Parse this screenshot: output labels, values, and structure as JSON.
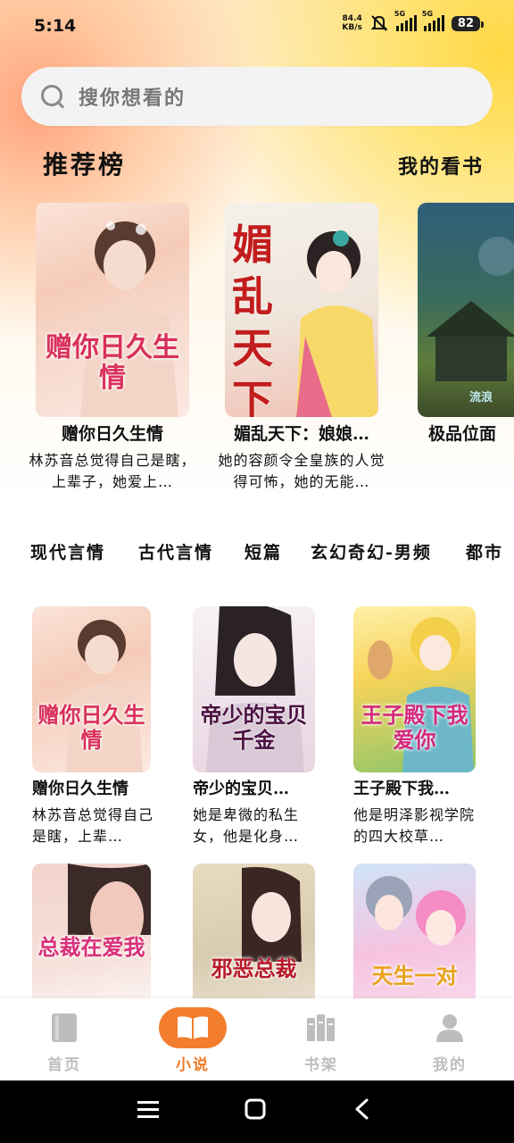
{
  "status_bar": {
    "time": "5:14",
    "net_speed_value": "84.4",
    "net_speed_unit": "KB/s",
    "signal1_label": "5G",
    "signal2_label": "5G",
    "battery": "82"
  },
  "search": {
    "placeholder": "搜你想看的"
  },
  "recommend": {
    "title": "推荐榜",
    "link": "我的看书",
    "books": [
      {
        "name": "赠你日久生情",
        "desc": "林苏音总觉得自己是瞎，上辈子，她爱上…",
        "cover_title": "赠你日久生情"
      },
      {
        "name": "媚乱天下：娘娘…",
        "desc": "她的容颜令全皇族的人觉得可怖，她的无能…",
        "cover_title": "媚乱天下"
      },
      {
        "name": "极品位面",
        "desc": "",
        "cover_title": "流浪"
      }
    ]
  },
  "categories": [
    "现代言情",
    "古代言情",
    "短篇",
    "玄幻奇幻-男频",
    "都市"
  ],
  "grid": [
    {
      "name": "赠你日久生情",
      "desc": "林苏音总觉得自己是瞎，上辈…",
      "cover_title": "赠你日久生情"
    },
    {
      "name": "帝少的宝贝…",
      "desc": "她是卑微的私生女，他是化身…",
      "cover_title": "帝少的宝贝千金"
    },
    {
      "name": "王子殿下我…",
      "desc": "他是明泽影视学院的四大校草…",
      "cover_title": "王子殿下我爱你"
    },
    {
      "name": "",
      "desc": "",
      "cover_title": "总裁在爱我"
    },
    {
      "name": "",
      "desc": "",
      "cover_title": "邪恶总裁"
    },
    {
      "name": "",
      "desc": "",
      "cover_title": "天生一对"
    }
  ],
  "bottom_nav": [
    {
      "label": "首页",
      "icon": "home-book-icon",
      "active": false
    },
    {
      "label": "小说",
      "icon": "open-book-icon",
      "active": true
    },
    {
      "label": "书架",
      "icon": "bookshelf-icon",
      "active": false
    },
    {
      "label": "我的",
      "icon": "profile-icon",
      "active": false
    }
  ],
  "colors": {
    "accent": "#f27d2d",
    "inactive": "#bdbdbd"
  }
}
